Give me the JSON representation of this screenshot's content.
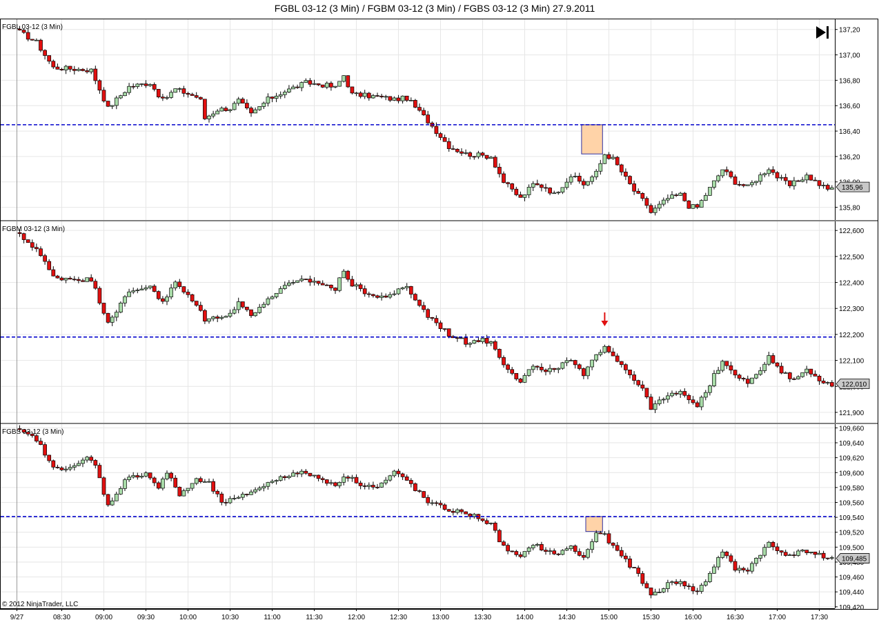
{
  "window": {
    "title": "FGBL 03-12 (3 Min) / FGBM 03-12 (3 Min) / FGBS 03-12 (3 Min)  27.9.2011",
    "copyright": "© 2012 NinjaTrader, LLC",
    "play_icon": "skip-to-end-icon"
  },
  "colors": {
    "up_candle": "#a8dba8",
    "down_candle": "#e01010",
    "candle_outline": "#000000",
    "level_line": "#0000cc",
    "highlight_box": "#ffd3a8",
    "highlight_border": "#3030a0",
    "arrow": "#e01010",
    "grid": "#e6e6e6",
    "price_badge": "#c8c8c8"
  },
  "chart_data": [
    {
      "type": "candlestick",
      "label": "FGBL 03-12 (3 Min)",
      "x_ticks": [
        "9/27",
        "08:30",
        "09:00",
        "09:30",
        "10:00",
        "10:30",
        "11:00",
        "11:30",
        "12:00",
        "12:30",
        "13:00",
        "13:30",
        "14:00",
        "14:30",
        "15:00",
        "15:30",
        "16:00",
        "16:30",
        "17:00",
        "17:30"
      ],
      "y_ticks": [
        "137,20",
        "137,00",
        "136,80",
        "136,60",
        "136,40",
        "136,20",
        "136,00",
        "135,80"
      ],
      "ylim": [
        135.7,
        137.28
      ],
      "level_line": 136.45,
      "last_price": "135,96",
      "highlight": {
        "start": "14:42",
        "end": "14:54",
        "low": 136.22,
        "high": 136.45
      },
      "anchors": [
        [
          "08:00",
          137.18
        ],
        [
          "08:12",
          137.1
        ],
        [
          "08:24",
          136.9
        ],
        [
          "08:51",
          136.88
        ],
        [
          "09:03",
          136.58
        ],
        [
          "09:18",
          136.75
        ],
        [
          "09:33",
          136.78
        ],
        [
          "09:42",
          136.64
        ],
        [
          "09:51",
          136.73
        ],
        [
          "10:06",
          136.67
        ],
        [
          "10:09",
          136.64
        ],
        [
          "10:12",
          136.5
        ],
        [
          "10:21",
          136.57
        ],
        [
          "10:30",
          136.58
        ],
        [
          "10:36",
          136.64
        ],
        [
          "10:45",
          136.53
        ],
        [
          "10:57",
          136.65
        ],
        [
          "11:06",
          136.7
        ],
        [
          "11:24",
          136.78
        ],
        [
          "11:39",
          136.76
        ],
        [
          "11:45",
          136.74
        ],
        [
          "11:51",
          136.84
        ],
        [
          "11:57",
          136.69
        ],
        [
          "12:15",
          136.67
        ],
        [
          "12:27",
          136.65
        ],
        [
          "12:36",
          136.66
        ],
        [
          "12:51",
          136.48
        ],
        [
          "12:54",
          136.44
        ],
        [
          "13:06",
          136.28
        ],
        [
          "13:18",
          136.22
        ],
        [
          "13:27",
          136.21
        ],
        [
          "13:36",
          136.2
        ],
        [
          "13:45",
          136.0
        ],
        [
          "13:57",
          135.87
        ],
        [
          "14:06",
          135.98
        ],
        [
          "14:15",
          135.96
        ],
        [
          "14:21",
          135.9
        ],
        [
          "14:33",
          136.05
        ],
        [
          "14:42",
          135.98
        ],
        [
          "14:51",
          136.07
        ],
        [
          "14:57",
          136.22
        ],
        [
          "15:03",
          136.18
        ],
        [
          "15:18",
          135.93
        ],
        [
          "15:27",
          135.82
        ],
        [
          "15:30",
          135.76
        ],
        [
          "15:42",
          135.87
        ],
        [
          "15:51",
          135.9
        ],
        [
          "15:57",
          135.81
        ],
        [
          "16:03",
          135.8
        ],
        [
          "16:09",
          135.9
        ],
        [
          "16:21",
          136.1
        ],
        [
          "16:30",
          136.0
        ],
        [
          "16:39",
          135.96
        ],
        [
          "16:45",
          136.02
        ],
        [
          "16:54",
          136.11
        ],
        [
          "17:00",
          136.04
        ],
        [
          "17:09",
          135.97
        ],
        [
          "17:21",
          136.05
        ],
        [
          "17:30",
          135.98
        ],
        [
          "17:36",
          135.94
        ],
        [
          "17:39",
          135.96
        ]
      ]
    },
    {
      "type": "candlestick",
      "label": "FGBM 03-12 (3 Min)",
      "x_ticks": [
        "9/27",
        "08:30",
        "09:00",
        "09:30",
        "10:00",
        "10:30",
        "11:00",
        "11:30",
        "12:00",
        "12:30",
        "13:00",
        "13:30",
        "14:00",
        "14:30",
        "15:00",
        "15:30",
        "16:00",
        "16:30",
        "17:00",
        "17:30"
      ],
      "y_ticks": [
        "122,600",
        "122,500",
        "122,400",
        "122,300",
        "122,200",
        "122,100",
        "122,000",
        "121,900"
      ],
      "ylim": [
        121.86,
        122.635
      ],
      "level_line": 122.19,
      "last_price": "122,010",
      "arrow_at": "14:57",
      "anchors": [
        [
          "08:00",
          122.58
        ],
        [
          "08:12",
          122.53
        ],
        [
          "08:24",
          122.42
        ],
        [
          "08:51",
          122.41
        ],
        [
          "09:03",
          122.25
        ],
        [
          "09:18",
          122.36
        ],
        [
          "09:33",
          122.39
        ],
        [
          "09:42",
          122.32
        ],
        [
          "09:51",
          122.4
        ],
        [
          "10:06",
          122.31
        ],
        [
          "10:09",
          122.3
        ],
        [
          "10:12",
          122.25
        ],
        [
          "10:21",
          122.27
        ],
        [
          "10:30",
          122.28
        ],
        [
          "10:36",
          122.32
        ],
        [
          "10:45",
          122.28
        ],
        [
          "10:57",
          122.33
        ],
        [
          "11:06",
          122.38
        ],
        [
          "11:24",
          122.41
        ],
        [
          "11:39",
          122.39
        ],
        [
          "11:45",
          122.37
        ],
        [
          "11:51",
          122.45
        ],
        [
          "11:57",
          122.39
        ],
        [
          "12:15",
          122.34
        ],
        [
          "12:27",
          122.36
        ],
        [
          "12:36",
          122.38
        ],
        [
          "12:51",
          122.27
        ],
        [
          "12:54",
          122.26
        ],
        [
          "13:06",
          122.2
        ],
        [
          "13:18",
          122.17
        ],
        [
          "13:27",
          122.18
        ],
        [
          "13:36",
          122.17
        ],
        [
          "13:45",
          122.09
        ],
        [
          "13:57",
          122.02
        ],
        [
          "14:06",
          122.08
        ],
        [
          "14:15",
          122.05
        ],
        [
          "14:21",
          122.07
        ],
        [
          "14:33",
          122.1
        ],
        [
          "14:42",
          122.04
        ],
        [
          "14:51",
          122.12
        ],
        [
          "14:57",
          122.16
        ],
        [
          "15:03",
          122.12
        ],
        [
          "15:18",
          122.03
        ],
        [
          "15:27",
          121.96
        ],
        [
          "15:30",
          121.92
        ],
        [
          "15:42",
          121.96
        ],
        [
          "15:51",
          121.98
        ],
        [
          "15:57",
          121.94
        ],
        [
          "16:03",
          121.93
        ],
        [
          "16:09",
          121.98
        ],
        [
          "16:21",
          122.1
        ],
        [
          "16:30",
          122.05
        ],
        [
          "16:39",
          122.02
        ],
        [
          "16:45",
          122.04
        ],
        [
          "16:54",
          122.11
        ],
        [
          "17:00",
          122.07
        ],
        [
          "17:09",
          122.03
        ],
        [
          "17:21",
          122.06
        ],
        [
          "17:30",
          122.03
        ],
        [
          "17:36",
          122.01
        ],
        [
          "17:39",
          122.01
        ]
      ]
    },
    {
      "type": "candlestick",
      "label": "FGBS 03-12 (3 Min)",
      "x_ticks": [
        "9/27",
        "08:30",
        "09:00",
        "09:30",
        "10:00",
        "10:30",
        "11:00",
        "11:30",
        "12:00",
        "12:30",
        "13:00",
        "13:30",
        "14:00",
        "14:30",
        "15:00",
        "15:30",
        "16:00",
        "16:30",
        "17:00",
        "17:30"
      ],
      "y_ticks": [
        "109,660",
        "109,640",
        "109,620",
        "109,600",
        "109,580",
        "109,560",
        "109,540",
        "109,520",
        "109,500",
        "109,480",
        "109,460",
        "109,440",
        "109,420"
      ],
      "ylim": [
        109.418,
        109.665
      ],
      "level_line": 109.541,
      "last_price": "109,485",
      "highlight": {
        "start": "14:45",
        "end": "14:54",
        "low": 109.521,
        "high": 109.541
      },
      "anchors": [
        [
          "08:00",
          109.655
        ],
        [
          "08:12",
          109.645
        ],
        [
          "08:24",
          109.605
        ],
        [
          "08:42",
          109.61
        ],
        [
          "08:48",
          109.62
        ],
        [
          "08:54",
          109.61
        ],
        [
          "09:03",
          109.555
        ],
        [
          "09:15",
          109.59
        ],
        [
          "09:30",
          109.6
        ],
        [
          "09:39",
          109.58
        ],
        [
          "09:45",
          109.6
        ],
        [
          "09:54",
          109.57
        ],
        [
          "10:06",
          109.59
        ],
        [
          "10:15",
          109.585
        ],
        [
          "10:24",
          109.56
        ],
        [
          "10:36",
          109.565
        ],
        [
          "10:45",
          109.575
        ],
        [
          "10:57",
          109.585
        ],
        [
          "11:06",
          109.595
        ],
        [
          "11:24",
          109.6
        ],
        [
          "11:36",
          109.59
        ],
        [
          "11:45",
          109.585
        ],
        [
          "11:54",
          109.595
        ],
        [
          "12:03",
          109.585
        ],
        [
          "12:15",
          109.58
        ],
        [
          "12:27",
          109.6
        ],
        [
          "12:36",
          109.59
        ],
        [
          "12:51",
          109.56
        ],
        [
          "13:06",
          109.55
        ],
        [
          "13:18",
          109.545
        ],
        [
          "13:27",
          109.54
        ],
        [
          "13:36",
          109.53
        ],
        [
          "13:45",
          109.5
        ],
        [
          "13:57",
          109.485
        ],
        [
          "14:06",
          109.505
        ],
        [
          "14:15",
          109.495
        ],
        [
          "14:21",
          109.49
        ],
        [
          "14:33",
          109.5
        ],
        [
          "14:42",
          109.485
        ],
        [
          "14:51",
          109.52
        ],
        [
          "14:57",
          109.515
        ],
        [
          "15:03",
          109.5
        ],
        [
          "15:18",
          109.47
        ],
        [
          "15:27",
          109.445
        ],
        [
          "15:30",
          109.435
        ],
        [
          "15:42",
          109.45
        ],
        [
          "15:51",
          109.455
        ],
        [
          "15:57",
          109.445
        ],
        [
          "16:03",
          109.44
        ],
        [
          "16:09",
          109.455
        ],
        [
          "16:21",
          109.495
        ],
        [
          "16:30",
          109.47
        ],
        [
          "16:39",
          109.47
        ],
        [
          "16:45",
          109.485
        ],
        [
          "16:54",
          109.505
        ],
        [
          "17:00",
          109.495
        ],
        [
          "17:09",
          109.49
        ],
        [
          "17:21",
          109.495
        ],
        [
          "17:30",
          109.49
        ],
        [
          "17:36",
          109.482
        ],
        [
          "17:39",
          109.485
        ]
      ]
    }
  ]
}
